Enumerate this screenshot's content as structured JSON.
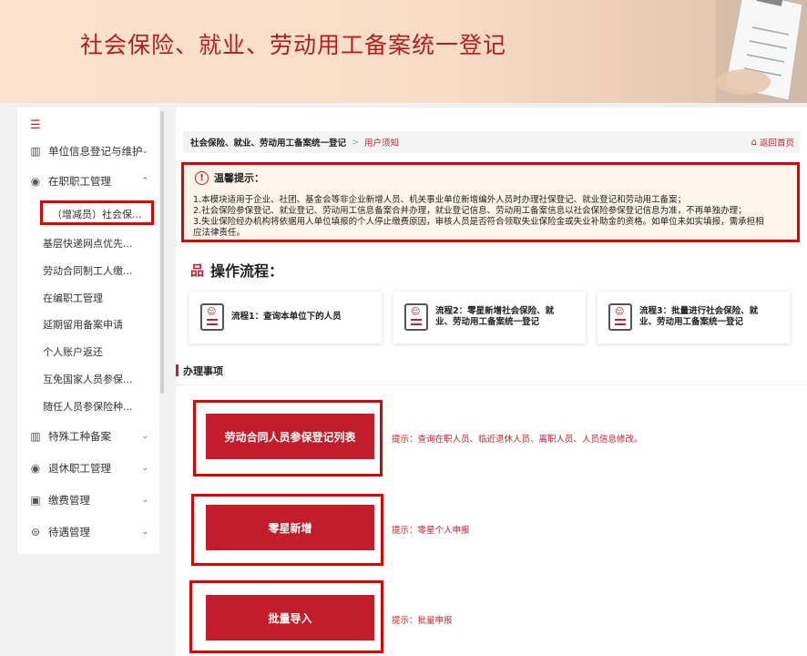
{
  "banner": {
    "title": "社会保险、就业、劳动用工备案统一登记"
  },
  "sidebar": {
    "toggle_icon": "menu-icon",
    "groups": [
      {
        "label": "单位信息登记与维护",
        "icon": "building-icon",
        "chevron": "⌄"
      },
      {
        "label": "在职职工管理",
        "icon": "person-circle-icon",
        "chevron": "⌃"
      },
      {
        "label": "特殊工种备案",
        "icon": "building-icon",
        "chevron": "⌄"
      },
      {
        "label": "退休职工管理",
        "icon": "person-circle-icon",
        "chevron": "⌄"
      },
      {
        "label": "缴费管理",
        "icon": "wallet-icon",
        "chevron": "⌄"
      },
      {
        "label": "待遇管理",
        "icon": "coin-icon",
        "chevron": "⌄"
      }
    ],
    "sub_items": [
      "（增减员）社会保...",
      "基层快递网点优先...",
      "劳动合同制工人缴...",
      "在编职工管理",
      "延期留用备案申请",
      "个人账户返还",
      "互免国家人员参保...",
      "随任人员参保险种..."
    ]
  },
  "breadcrumb": {
    "parent": "社会保险、就业、劳动用工备案统一登记",
    "separator": ">",
    "current": "用户须知",
    "home": "返回首页"
  },
  "tip": {
    "title": "温馨提示：",
    "lines": [
      "1.本模块适用于企业、社团、基金会等非企业新增人员、机关事业单位新增编外人员时办理社保登记、就业登记和劳动用工备案；",
      "2.社会保险参保登记、就业登记、劳动用工信息备案合并办理，就业登记信息、劳动用工备案信息以社会保险参保登记信息为准，不再单独办理；",
      "3.失业保险经办机构将依据用人单位填报的个人停止缴费原因，审核人员是否符合领取失业保险金或失业补助金的资格。如单位未如实填报，需承担相",
      "应法律责任。"
    ]
  },
  "flow": {
    "title": "操作流程：",
    "steps": [
      {
        "line1": "流程1：查询本单位下的人员",
        "line2": ""
      },
      {
        "line1": "流程2：零星新增社会保险、就",
        "line2": "业、劳动用工备案统一登记"
      },
      {
        "line1": "流程3：批量进行社会保险、就",
        "line2": "业、劳动用工备案统一登记"
      }
    ]
  },
  "section": {
    "title": "办理事项"
  },
  "actions": [
    {
      "label": "劳动合同人员参保登记列表",
      "hint": "提示：查询在职人员、临近退休人员、离职人员、人员信息修改。"
    },
    {
      "label": "零星新增",
      "hint": "提示：零星个人申报"
    },
    {
      "label": "批量导入",
      "hint": "提示：批量申报"
    }
  ],
  "colors": {
    "accent": "#c31d2b",
    "highlight": "#e00000"
  }
}
